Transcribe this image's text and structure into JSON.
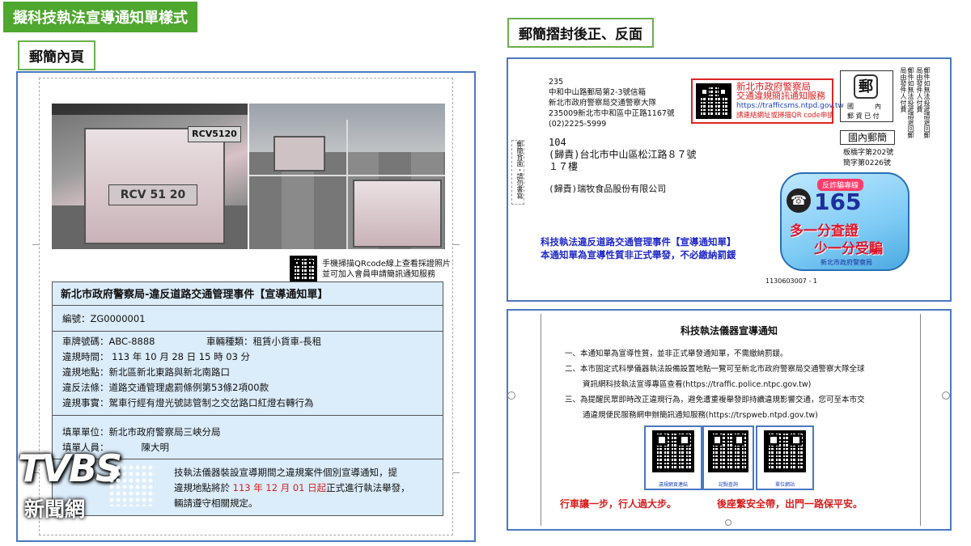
{
  "headers": {
    "main_title": "擬科技執法宣導通知單樣式",
    "inner_page": "郵簡內頁",
    "folded": "郵簡摺封後正、反面"
  },
  "inner": {
    "qr_caption_1": "手機掃描QRcode線上查看採證照片",
    "qr_caption_2": "並可加入會員申請簡訊通知服務",
    "photo_plate": "RCV 51 20",
    "photo_plate_small": "RCV5120",
    "doc_title": "新北市政府警察局-違反道路交通管理事件【宣導通知單】",
    "number": "編號：ZG0000001",
    "plate_label": "車牌號碼：ABC-8888",
    "vehicle_type": "車輛種類：租賃小貨車-長租",
    "time": "違規時間： 113 年 10 月 28 日 15 時 03 分",
    "location": "違規地點：新北區新北東路與新北南路口",
    "law": "違反法條：道路交通管理處罰條例第53條2項00款",
    "fact": "違規事實：駕車行經有燈光號誌管制之交岔路口紅燈右轉行為",
    "unit": "填單單位：新北市政府警察局三峽分局",
    "person": "填單人員：",
    "person_name": "陳大明",
    "para_1": "技執法儀器裝設宣導期間之違規案件個別宣導通知，提",
    "para_2a": "違規地點將於",
    "para_2_date": "113 年 12 月 01 日起",
    "para_2b": "正式進行執法舉發，",
    "para_3": "輛請遵守相關規定。"
  },
  "front": {
    "postcode": "235",
    "sender_1": "中和中山路郵局第2-3號信箱",
    "sender_2": "新北市政府警察局交通警察大隊",
    "sender_3": "235009新北市中和區中正路1167號",
    "sender_4": "(02)2225-5999",
    "qr_box_1": "新北市政府警察局",
    "qr_box_2": "交通違規簡訊通知服務",
    "qr_box_3": "https://trafficsms.ntpd.gov.tw",
    "qr_box_4": "請連結網址或掃描QR code申請",
    "postage_1": "國",
    "postage_2": "內",
    "postage_3": "郵 資 已 付",
    "domestic": "國內郵簡",
    "permit_1": "板橋字第202號",
    "permit_2": "簡字第0226號",
    "recipient_zip": "104",
    "recipient_addr": "(歸責)台北市中山區松江路８７號",
    "recipient_floor": "１７樓",
    "recipient_company": "(歸責)瑞牧食品股份有限公司",
    "side_note": "郵簡背面・請勿書寫",
    "right_note": "郵件如無法投遞請退回郵局由發件人付費",
    "blue_1": "科技執法違反道路交通管理事件【宣導通知單】",
    "blue_2": "本通知單為宣導性質非正式舉發，不必繳納罰鍰",
    "barcode_no": "1130603007 - 1",
    "badge_top": "反詐騙專線",
    "badge_number": "165",
    "badge_line_1": "多一分查證",
    "badge_line_2": "少一分受騙",
    "badge_footer": "新北市政府警察局"
  },
  "back": {
    "title": "科技執法儀器宣導通知",
    "item_1": "一、本通知單為宣導性質，並非正式舉發通知單，不需繳納罰鍰。",
    "item_2a": "二、本市固定式科學儀器執法設備設置地點一覽可至新北市政府警察局交通警察大隊全球",
    "item_2b": "資訊網科技執法宣導專區查看(https://traffic.police.ntpc.gov.tw)",
    "item_3a": "三、為提醒民眾即時改正違規行為，避免遭重複舉發即持續違規影響交通，您可至本市交",
    "item_3b": "通違規便民服務網申辦簡訊通知服務(https://trspweb.ntpd.gov.tw)",
    "qr_1": "違規網頁連結",
    "qr_2": "記點查詢",
    "qr_3": "單位網站",
    "slogan_1": "行車讓一步，行人過大步。",
    "slogan_2": "後座繫安全帶，出門一路保平安。"
  },
  "watermark": {
    "logo": "TVBS",
    "sub": "新聞網"
  }
}
